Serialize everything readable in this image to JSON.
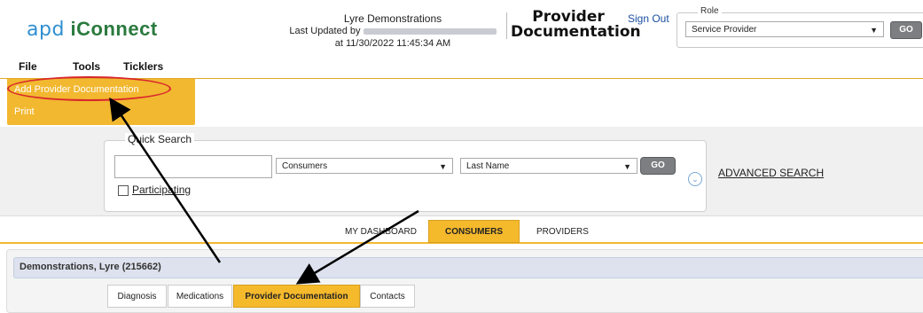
{
  "header": {
    "logo_prefix": "apd",
    "logo_name": "iConnect",
    "user_name": "Lyre Demonstrations",
    "last_updated_label": "Last Updated by",
    "last_updated_time": "at 11/30/2022 11:45:34 AM",
    "module_title_line1": "Provider",
    "module_title_line2": "Documentation",
    "sign_out": "Sign Out"
  },
  "role": {
    "legend": "Role",
    "selected": "Service Provider",
    "go": "GO"
  },
  "menu": {
    "file": "File",
    "tools": "Tools",
    "ticklers": "Ticklers",
    "dropdown": [
      "Add Provider Documentation",
      "Print"
    ]
  },
  "quick_search": {
    "legend": "Quick Search",
    "input_value": "",
    "type_selected": "Consumers",
    "field_selected": "Last Name",
    "go": "GO",
    "participating_label": "Participating",
    "advanced": "ADVANCED SEARCH"
  },
  "main_tabs": [
    "MY DASHBOARD",
    "CONSUMERS",
    "PROVIDERS"
  ],
  "consumer": {
    "name": "Demonstrations, Lyre (215662)"
  },
  "sub_tabs": [
    "Diagnosis",
    "Medications",
    "Provider Documentation",
    "Contacts"
  ],
  "colors": {
    "accent": "#f2b830",
    "annotation": "#d8262b",
    "link": "#1a4ea0"
  }
}
